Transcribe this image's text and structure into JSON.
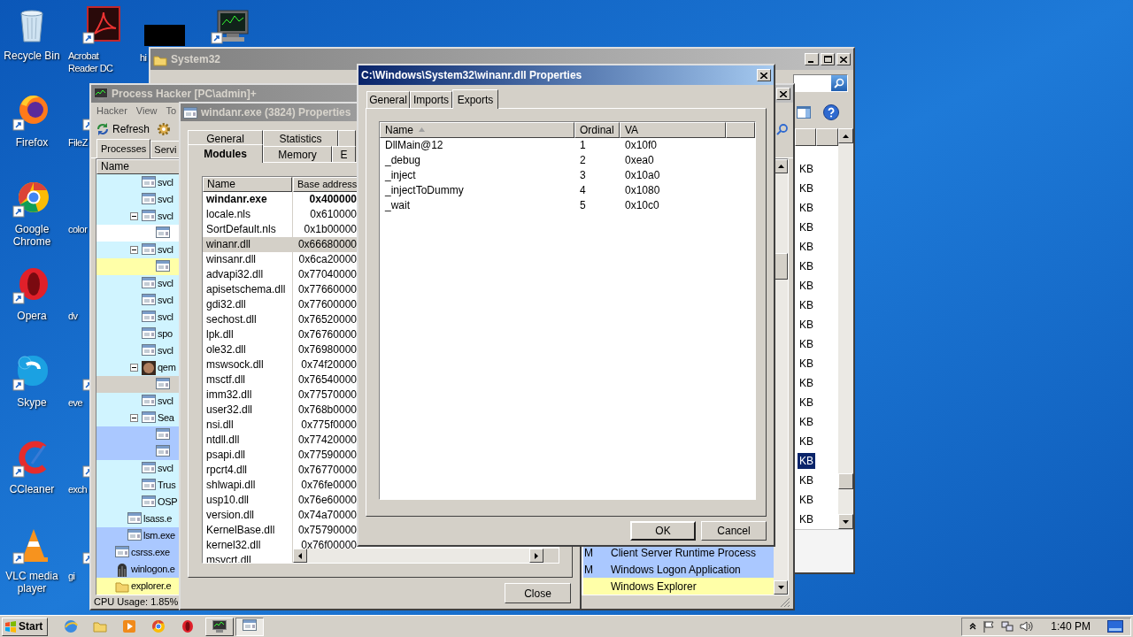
{
  "desktop": {
    "columns": [
      [
        {
          "label": "Recycle Bin",
          "kind": "recycle"
        },
        {
          "label": "Firefox",
          "kind": "firefox"
        },
        {
          "label": "Google Chrome",
          "kind": "chrome"
        },
        {
          "label": "Opera",
          "kind": "opera"
        },
        {
          "label": "Skype",
          "kind": "skype"
        },
        {
          "label": "CCleaner",
          "kind": "ccleaner"
        },
        {
          "label": "VLC media player",
          "kind": "vlc"
        }
      ],
      [
        {
          "label": "Acrobat Reader DC",
          "kind": "acrobat"
        },
        {
          "label": "FileZ",
          "kind": "filezilla"
        },
        {
          "label": "color"
        },
        {
          "label": "dv"
        },
        {
          "label": "eve",
          "kind": "document"
        },
        {
          "label": "exch",
          "kind": "document"
        },
        {
          "label": "gi",
          "kind": "document"
        }
      ],
      [
        {
          "label": "hi",
          "kind": "black"
        }
      ],
      [
        {
          "kind": "monitor"
        }
      ]
    ]
  },
  "system32": {
    "title": "System32",
    "rows": [
      {
        "size": "KB",
        "selected": false
      },
      {
        "size": "KB",
        "selected": false
      },
      {
        "size": "KB",
        "selected": false
      },
      {
        "size": "KB",
        "selected": false
      },
      {
        "size": "KB",
        "selected": false
      },
      {
        "size": "KB",
        "selected": false
      },
      {
        "size": "KB",
        "selected": false
      },
      {
        "size": "KB",
        "selected": false
      },
      {
        "size": "KB",
        "selected": false
      },
      {
        "size": "KB",
        "selected": false
      },
      {
        "size": "KB",
        "selected": false
      },
      {
        "size": "KB",
        "selected": false
      },
      {
        "size": "KB",
        "selected": false
      },
      {
        "size": "KB",
        "selected": false
      },
      {
        "size": "KB",
        "selected": false
      },
      {
        "size": "KB",
        "selected": true
      },
      {
        "size": "KB",
        "selected": false
      },
      {
        "size": "KB",
        "selected": false
      },
      {
        "size": "KB",
        "selected": false
      }
    ]
  },
  "process_hacker": {
    "title": "Process Hacker [PC\\admin]+",
    "menu": [
      "Hacker",
      "View",
      "To"
    ],
    "refresh": "Refresh",
    "tabs": [
      {
        "label": "Processes",
        "selected": true
      },
      {
        "label": "Servi",
        "selected": false
      }
    ],
    "name_column": "Name",
    "groups": [
      {
        "kind": "deep",
        "rows": [
          {
            "name": "svcl",
            "color": "#d0f4ff"
          },
          {
            "name": "svcl",
            "color": "#d0f4ff"
          },
          {
            "name": "svcl",
            "color": "#d0f4ff",
            "children": [
              {
                "color": "#ffffff"
              }
            ]
          },
          {
            "name": "svcl",
            "color": "#d0f4ff",
            "children": [
              {
                "color": "#ffffa8"
              }
            ]
          },
          {
            "name": "svcl",
            "color": "#d0f4ff"
          },
          {
            "name": "svcl",
            "color": "#d0f4ff"
          },
          {
            "name": "svcl",
            "color": "#d0f4ff"
          },
          {
            "name": "spo",
            "color": "#d0f4ff"
          },
          {
            "name": "svcl",
            "color": "#d0f4ff"
          },
          {
            "name": "qem",
            "color": "#d0f4ff",
            "kind": "photo",
            "children": [
              {
                "color": "#d4d0c8"
              }
            ]
          },
          {
            "name": "svcl",
            "color": "#d0f4ff"
          },
          {
            "name": "Sea",
            "color": "#d0f4ff",
            "children": [
              {
                "color": "#aac8ff"
              },
              {
                "color": "#aac8ff"
              }
            ]
          },
          {
            "name": "svcl",
            "color": "#d0f4ff"
          },
          {
            "name": "Trus",
            "color": "#d0f4ff"
          },
          {
            "name": "OSP",
            "color": "#d0f4ff"
          }
        ]
      },
      {
        "kind": "mid",
        "rows": [
          {
            "name": "lsass.e",
            "color": "#d0f4ff"
          },
          {
            "name": "lsm.exe",
            "color": "#aac8ff"
          }
        ]
      },
      {
        "kind": "top",
        "rows": [
          {
            "name": "csrss.exe",
            "color": "#aac8ff",
            "user": "M",
            "description": "Client Server Runtime Process"
          },
          {
            "name": "winlogon.e",
            "color": "#aac8ff",
            "kind": "winlogon",
            "user": "M",
            "description": "Windows Logon Application"
          },
          {
            "name": "explorer.e",
            "color": "#ffffa8",
            "kind": "folder",
            "description": "Windows Explorer"
          }
        ]
      }
    ],
    "status": "CPU Usage: 1.85%"
  },
  "module_window": {
    "title": "windanr.exe (3824) Properties",
    "tabs": [
      [
        {
          "label": "General",
          "selected": false
        },
        {
          "label": "Statistics",
          "selected": false
        },
        {
          "selected": false
        }
      ],
      [
        {
          "label": "Modules",
          "selected": true
        },
        {
          "label": "Memory",
          "selected": false
        },
        {
          "label": "E",
          "selected": false
        }
      ]
    ],
    "columns": [
      "Name",
      "Base address"
    ],
    "modules": [
      {
        "name": "windanr.exe",
        "base": "0x400000",
        "main": true,
        "selected": false
      },
      {
        "name": "locale.nls",
        "base": "0x610000",
        "main": false,
        "selected": false
      },
      {
        "name": "SortDefault.nls",
        "base": "0x1b00000",
        "main": false,
        "selected": false
      },
      {
        "name": "winanr.dll",
        "base": "0x66680000",
        "main": false,
        "selected": true
      },
      {
        "name": "winsanr.dll",
        "base": "0x6ca20000",
        "main": false,
        "selected": false
      },
      {
        "name": "advapi32.dll",
        "base": "0x77040000",
        "main": false,
        "selected": false
      },
      {
        "name": "apisetschema.dll",
        "base": "0x77660000",
        "main": false,
        "selected": false
      },
      {
        "name": "gdi32.dll",
        "base": "0x77600000",
        "main": false,
        "selected": false
      },
      {
        "name": "sechost.dll",
        "base": "0x76520000",
        "main": false,
        "selected": false
      },
      {
        "name": "lpk.dll",
        "base": "0x76760000",
        "main": false,
        "selected": false
      },
      {
        "name": "ole32.dll",
        "base": "0x76980000",
        "main": false,
        "selected": false
      },
      {
        "name": "mswsock.dll",
        "base": "0x74f20000",
        "main": false,
        "selected": false
      },
      {
        "name": "msctf.dll",
        "base": "0x76540000",
        "main": false,
        "selected": false
      },
      {
        "name": "imm32.dll",
        "base": "0x77570000",
        "main": false,
        "selected": false
      },
      {
        "name": "user32.dll",
        "base": "0x768b0000",
        "main": false,
        "selected": false
      },
      {
        "name": "nsi.dll",
        "base": "0x775f0000",
        "main": false,
        "selected": false
      },
      {
        "name": "ntdll.dll",
        "base": "0x77420000",
        "main": false,
        "selected": false
      },
      {
        "name": "psapi.dll",
        "base": "0x77590000",
        "main": false,
        "selected": false
      },
      {
        "name": "rpcrt4.dll",
        "base": "0x76770000",
        "main": false,
        "selected": false
      },
      {
        "name": "shlwapi.dll",
        "base": "0x76fe0000",
        "main": false,
        "selected": false
      },
      {
        "name": "usp10.dll",
        "base": "0x76e60000",
        "main": false,
        "selected": false
      },
      {
        "name": "version.dll",
        "base": "0x74a70000",
        "main": false,
        "selected": false
      },
      {
        "name": "KernelBase.dll",
        "base": "0x75790000",
        "main": false,
        "selected": false
      },
      {
        "name": "kernel32.dll",
        "base": "0x76f00000",
        "main": false,
        "selected": false
      },
      {
        "name": "msvcrt.dll",
        "main": false,
        "selected": false
      }
    ],
    "close": "Close"
  },
  "dll_dialog": {
    "title": "C:\\Windows\\System32\\winanr.dll Properties",
    "tabs": [
      {
        "label": "General",
        "selected": false
      },
      {
        "label": "Imports",
        "selected": false
      },
      {
        "label": "Exports",
        "selected": true
      }
    ],
    "columns": [
      {
        "label": "Name",
        "sorted": true
      },
      {
        "label": "Ordinal",
        "sorted": false
      },
      {
        "label": "VA",
        "sorted": false
      }
    ],
    "exports": [
      {
        "name": "DllMain@12",
        "ordinal": "1",
        "va": "0x10f0"
      },
      {
        "name": "_debug",
        "ordinal": "2",
        "va": "0xea0"
      },
      {
        "name": "_inject",
        "ordinal": "3",
        "va": "0x10a0"
      },
      {
        "name": "_injectToDummy",
        "ordinal": "4",
        "va": "0x1080"
      },
      {
        "name": "_wait",
        "ordinal": "5",
        "va": "0x10c0"
      }
    ],
    "buttons": [
      "OK",
      "Cancel"
    ]
  },
  "taskbar": {
    "start": "Start",
    "quick_launch": [
      {
        "kind": "browser"
      },
      {
        "kind": "folder"
      },
      {
        "kind": "media"
      },
      {
        "kind": "chrome"
      },
      {
        "kind": "opera"
      }
    ],
    "tasks": [
      {
        "kind": "monitor",
        "selected": false
      },
      {
        "kind": "window",
        "selected": true
      }
    ],
    "clock": "1:40 PM"
  }
}
